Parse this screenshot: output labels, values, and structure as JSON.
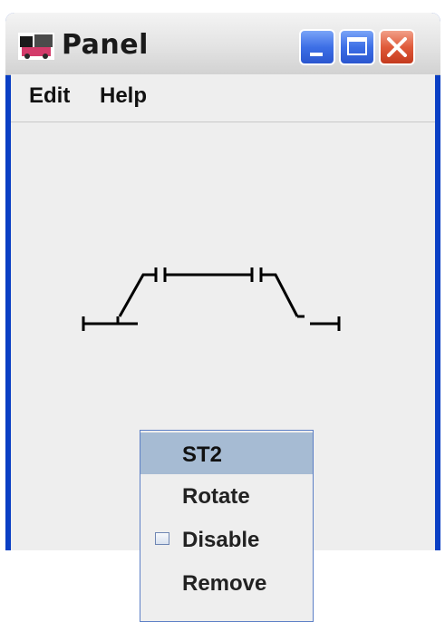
{
  "window": {
    "title": "Panel",
    "controls": {
      "minimize": "minimize-icon",
      "maximize": "maximize-icon",
      "close": "close-icon"
    }
  },
  "menubar": {
    "items": [
      {
        "label": "Edit"
      },
      {
        "label": "Help"
      }
    ]
  },
  "popup": {
    "items": [
      {
        "label": "ST2",
        "selected": true
      },
      {
        "label": "Rotate"
      },
      {
        "label": "Disable",
        "checkbox": true,
        "checked": false
      },
      {
        "label": "Remove"
      }
    ]
  },
  "colors": {
    "frame": "#0a3fc4",
    "menu_highlight": "#a6bbd3",
    "close_button": "#e05a3a"
  }
}
